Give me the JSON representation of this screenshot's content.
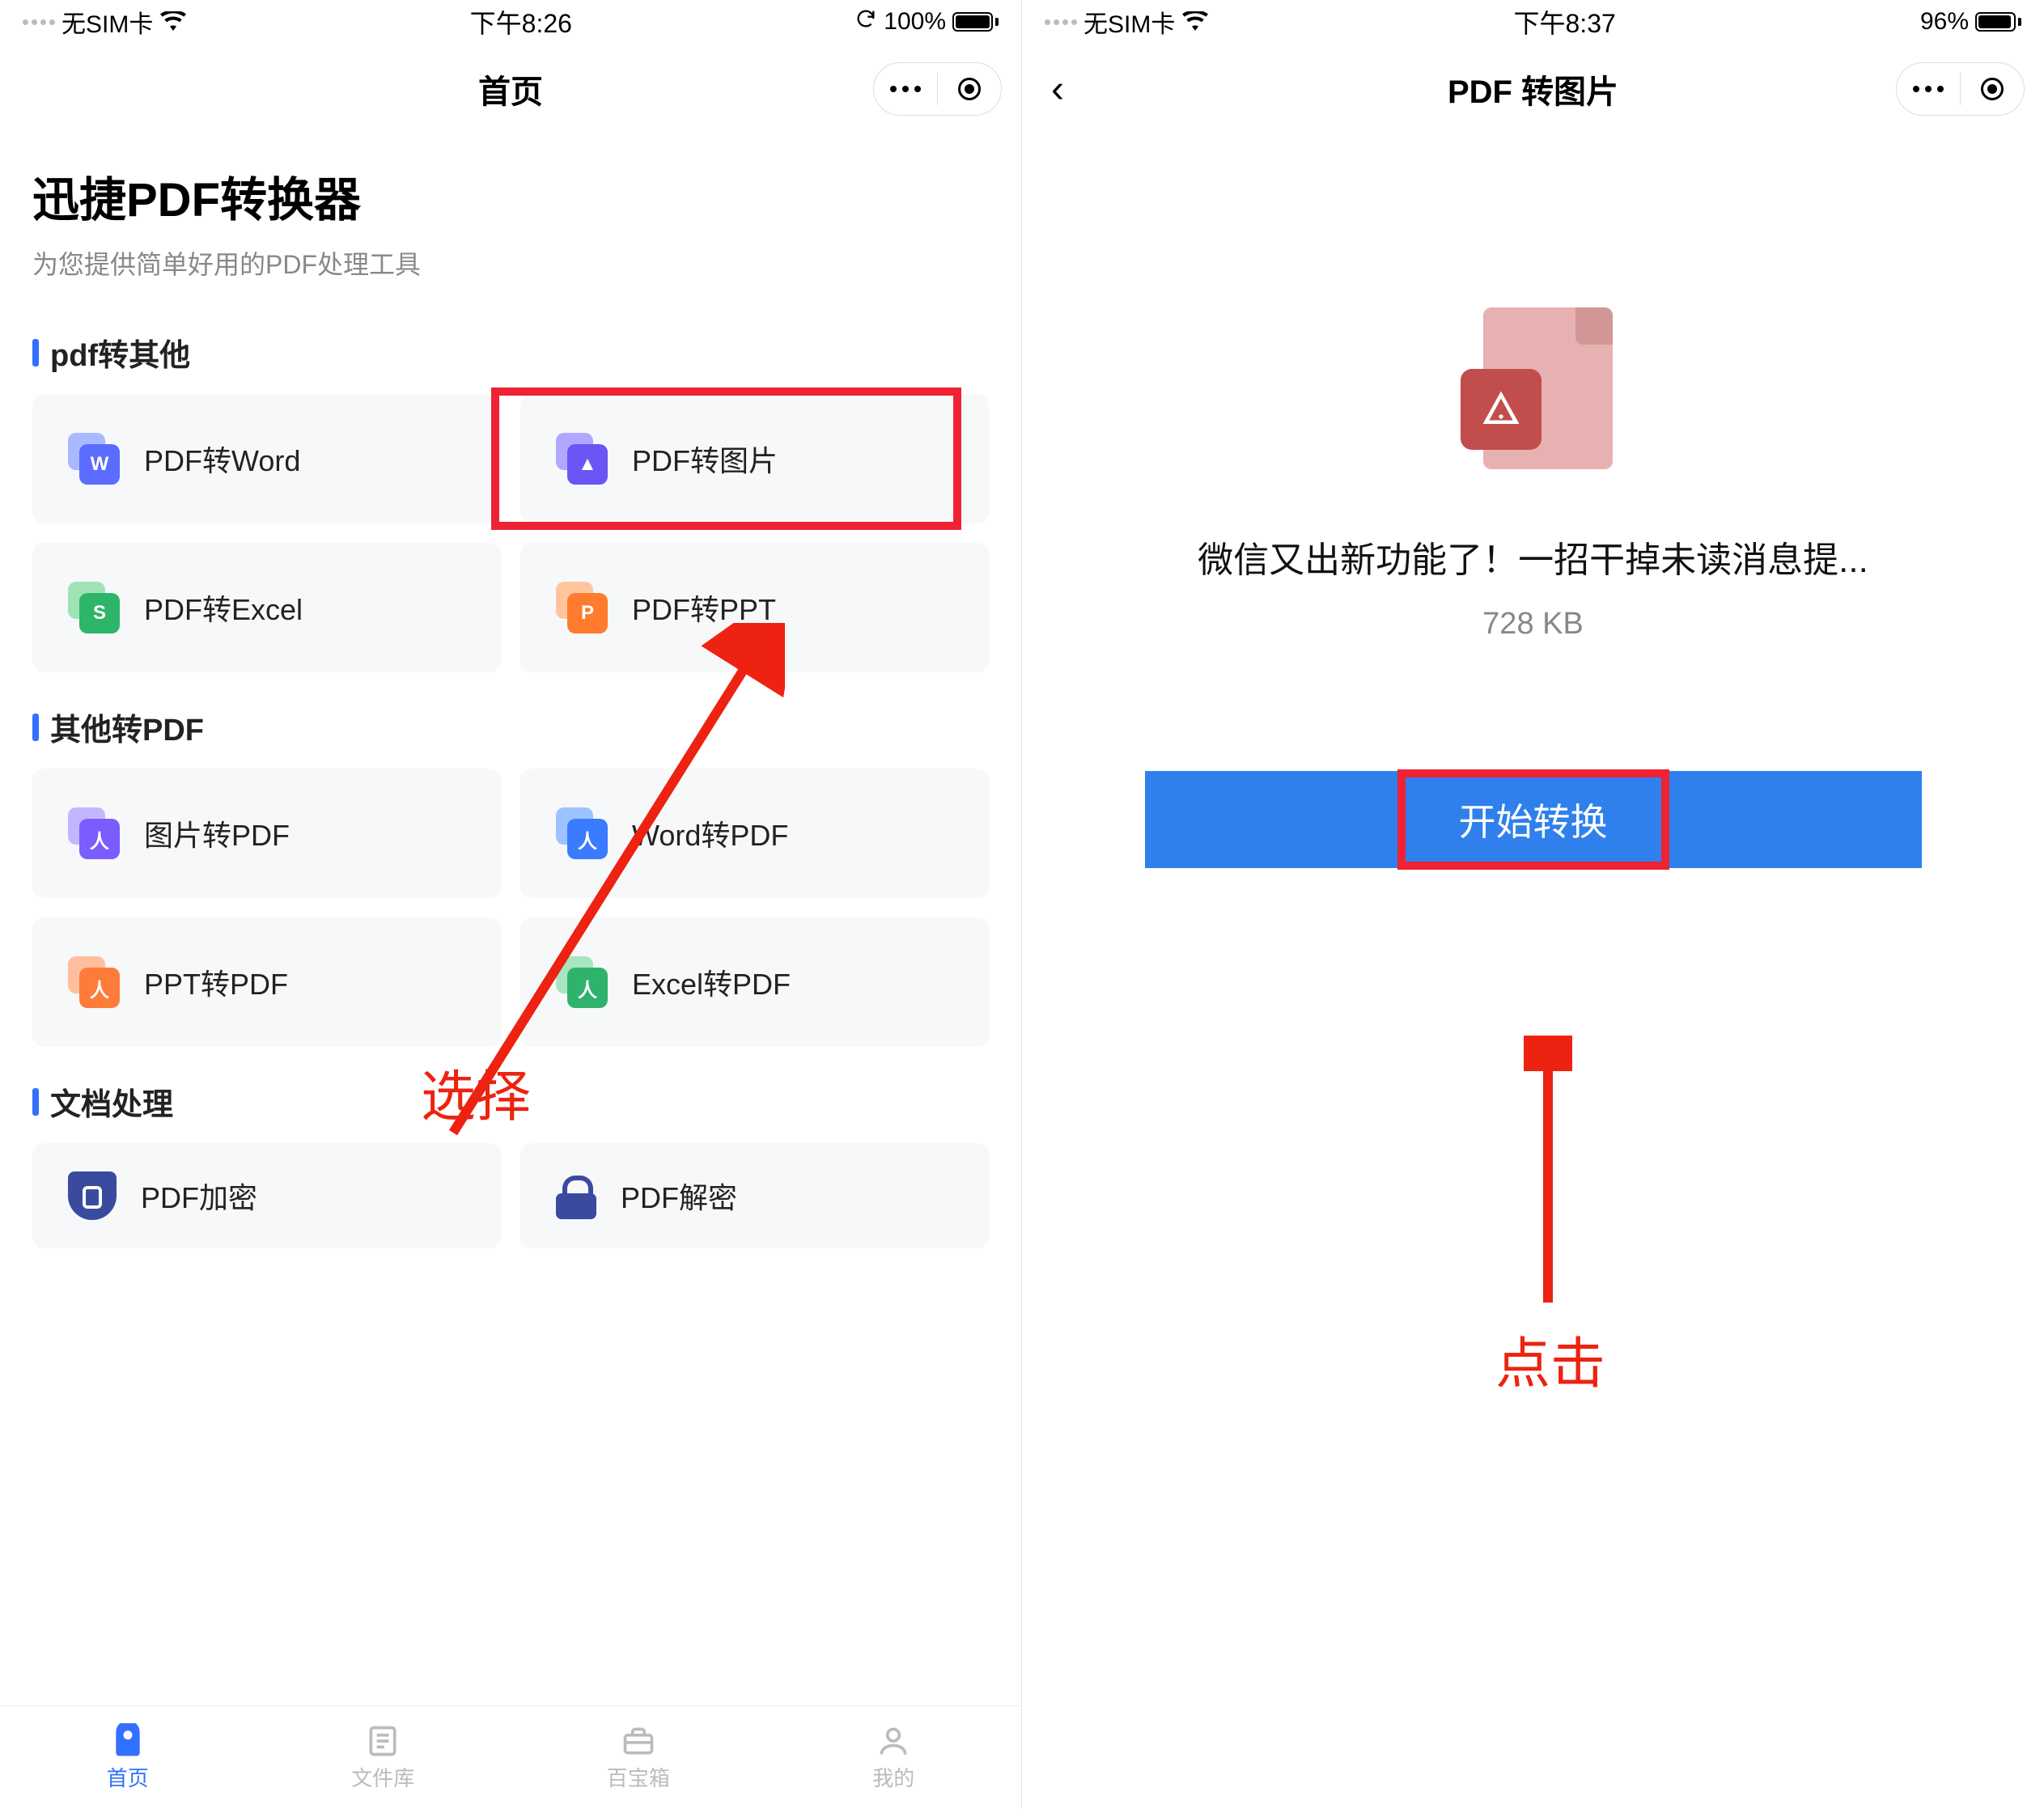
{
  "left": {
    "status": {
      "sim": "无SIM卡",
      "time": "下午8:26",
      "battery_text": "100%",
      "battery_fill": 100,
      "show_refresh": true
    },
    "nav_title": "首页",
    "app_title": "迅捷PDF转换器",
    "app_sub": "为您提供简单好用的PDF处理工具",
    "sections": {
      "s1_title": "pdf转其他",
      "s2_title": "其他转PDF",
      "s3_title": "文档处理"
    },
    "tools": {
      "pdf2word": "PDF转Word",
      "pdf2img": "PDF转图片",
      "pdf2excel": "PDF转Excel",
      "pdf2ppt": "PDF转PPT",
      "img2pdf": "图片转PDF",
      "word2pdf": "Word转PDF",
      "ppt2pdf": "PPT转PDF",
      "excel2pdf": "Excel转PDF",
      "pdf_encrypt": "PDF加密",
      "pdf_decrypt": "PDF解密"
    },
    "tabs": {
      "home": "首页",
      "files": "文件库",
      "toolbox": "百宝箱",
      "me": "我的"
    },
    "annotation": "选择"
  },
  "right": {
    "status": {
      "sim": "无SIM卡",
      "time": "下午8:37",
      "battery_text": "96%",
      "battery_fill": 96,
      "show_refresh": false
    },
    "nav_title": "PDF 转图片",
    "file_name": "微信又出新功能了！一招干掉未读消息提...",
    "file_size": "728 KB",
    "convert_btn": "开始转换",
    "annotation": "点击"
  }
}
